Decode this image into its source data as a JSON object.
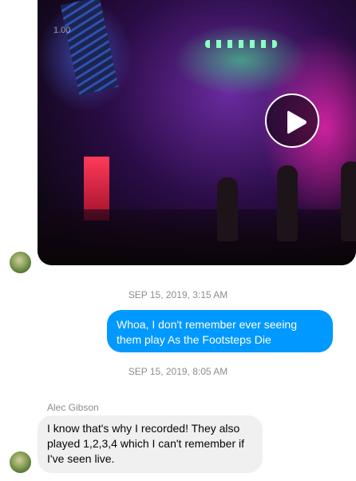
{
  "video_message": {
    "overlay_label": "1.00",
    "play_icon": "play-icon"
  },
  "timestamps": {
    "first": "SEP 15, 2019, 3:15 AM",
    "second": "SEP 15, 2019, 8:05 AM"
  },
  "outgoing_message": {
    "text": "Whoa, I don't remember ever seeing them play As the Footsteps Die"
  },
  "incoming_message": {
    "sender": "Alec Gibson",
    "text": "I know that's why I recorded! They also played 1,2,3,4 which I can't remember if I've seen live."
  },
  "colors": {
    "outgoing_bubble": "#0099ff",
    "incoming_bubble": "#f0f0f0",
    "timestamp_text": "#8a8d91"
  }
}
